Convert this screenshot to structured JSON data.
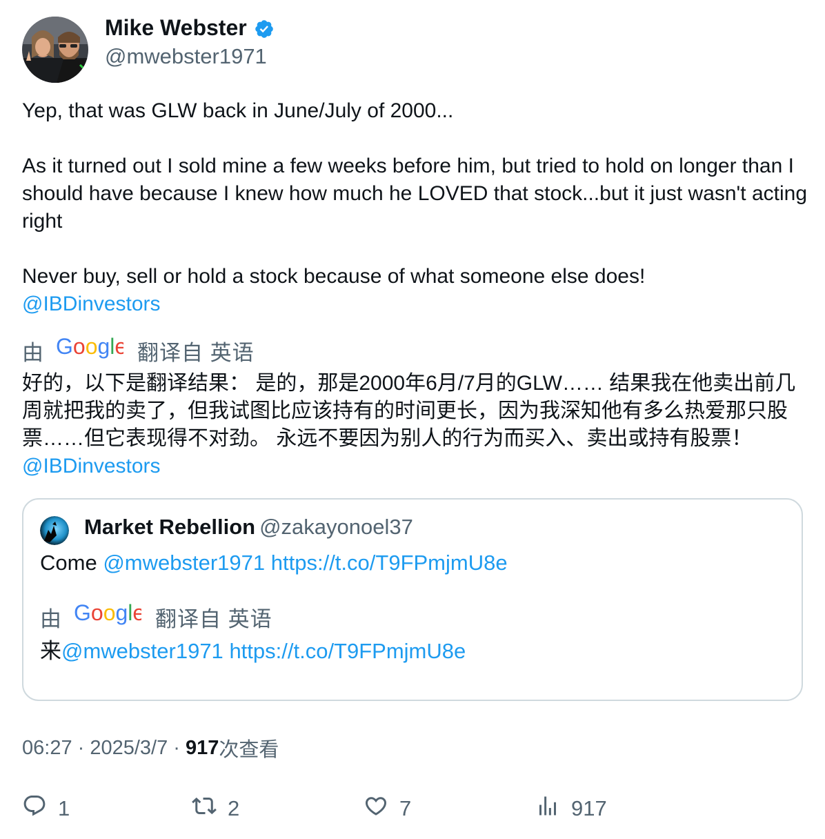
{
  "author": {
    "name": "Mike Webster",
    "handle": "@mwebster1971"
  },
  "tweet": {
    "para1": "Yep, that was GLW back in June/July of 2000...",
    "para2": "As it turned out I sold mine a few weeks before him, but tried to hold on longer than I should have because I knew how much he LOVED that stock...but it just wasn't acting right",
    "para3": "Never buy, sell or hold a stock because of what someone else does!",
    "mention": "@IBDinvestors"
  },
  "translation": {
    "by": "由",
    "from": "翻译自 英语",
    "text": "好的，以下是翻译结果： 是的，那是2000年6月/7月的GLW…… 结果我在他卖出前几周就把我的卖了，但我试图比应该持有的时间更长，因为我深知他有多么热爱那只股票……但它表现得不对劲。 永远不要因为别人的行为而买入、卖出或持有股票！",
    "mention": "@IBDinvestors"
  },
  "quote": {
    "name": "Market Rebellion",
    "handle": "@zakayonoel37",
    "text_prefix": "Come",
    "mention": "@mwebster1971",
    "url": "https://t.co/T9FPmjmU8e",
    "translation_by": "由",
    "translation_from": "翻译自 英语",
    "translated_prefix": "来",
    "translated_mention": "@mwebster1971",
    "translated_url": "https://t.co/T9FPmjmU8e"
  },
  "meta": {
    "time": "06:27",
    "sep1": " · ",
    "date": "2025/3/7",
    "sep2": " · ",
    "views_count": "917",
    "views_label": "次查看"
  },
  "actions": {
    "replies": "1",
    "retweets": "2",
    "likes": "7",
    "views": "917"
  },
  "colors": {
    "link": "#1d9bf0",
    "secondary_text": "#536471",
    "primary_text": "#0f1419",
    "border": "#cfd9de",
    "verified": "#1d9bf0"
  },
  "icons": [
    "verified-badge-icon",
    "google-logo",
    "reply-icon",
    "retweet-icon",
    "like-icon",
    "views-icon"
  ]
}
